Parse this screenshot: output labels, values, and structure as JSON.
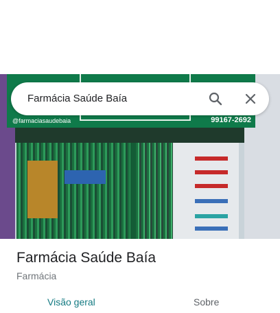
{
  "search": {
    "query": "Farmácia Saúde Baía",
    "search_icon": "search-icon",
    "close_icon": "close-icon"
  },
  "photo": {
    "sign_social": "@farmaciasaudebaia",
    "sign_phone": "99167-2692"
  },
  "place": {
    "name": "Farmácia Saúde Baía",
    "category": "Farmácia"
  },
  "tabs": [
    {
      "label": "Visão geral",
      "active": true
    },
    {
      "label": "Sobre",
      "active": false
    }
  ],
  "colors": {
    "accent": "#137a82",
    "sign_green": "#0f7a4a"
  }
}
